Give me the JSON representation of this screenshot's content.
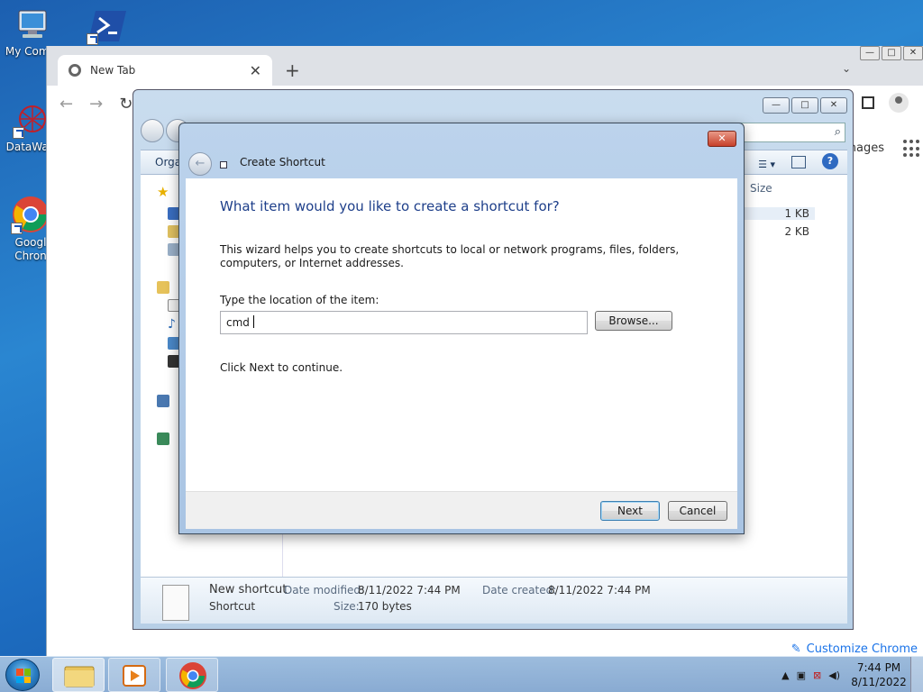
{
  "desktop": {
    "icons": [
      {
        "label": "My Comp",
        "icon": "computer-icon"
      },
      {
        "label": "",
        "icon": "powershell-icon"
      },
      {
        "label": "DataWag",
        "icon": "datawag-icon"
      },
      {
        "label": "Googl\nChron",
        "icon": "chrome-icon"
      }
    ]
  },
  "chrome": {
    "tab_title": "New Tab",
    "tab_close": "✕",
    "new_tab": "+",
    "tab_menu": "⌄",
    "images_link": "nages",
    "customize_label": "Customize Chrome",
    "window_buttons": [
      "—",
      "□",
      "✕"
    ]
  },
  "explorer": {
    "organize_label": "Orga",
    "column_size": "Size",
    "file_sizes": [
      "1 KB",
      "2 KB"
    ],
    "window_buttons": [
      "—",
      "□",
      "✕"
    ],
    "details": {
      "name": "New shortcut",
      "type": "Shortcut",
      "date_modified_label": "Date modified:",
      "date_modified": "8/11/2022 7:44 PM",
      "date_created_label": "Date created:",
      "date_created": "8/11/2022 7:44 PM",
      "size_label": "Size:",
      "size": "170 bytes"
    }
  },
  "dialog": {
    "title": "Create Shortcut",
    "close": "✕",
    "back": "←",
    "heading": "What item would you like to create a shortcut for?",
    "description": "This wizard helps you to create shortcuts to local or network programs, files, folders, computers, or Internet addresses.",
    "location_label": "Type the location of the item:",
    "location_value": "cmd",
    "browse_label": "Browse...",
    "continue_text": "Click Next to continue.",
    "next_label": "Next",
    "cancel_label": "Cancel"
  },
  "taskbar": {
    "time": "7:44 PM",
    "date": "8/11/2022",
    "tray_arrow": "▲"
  },
  "colors": {
    "heading_blue": "#1e3f8a",
    "close_red": "#c7402a",
    "desktop_blue": "#1d6cc0"
  }
}
